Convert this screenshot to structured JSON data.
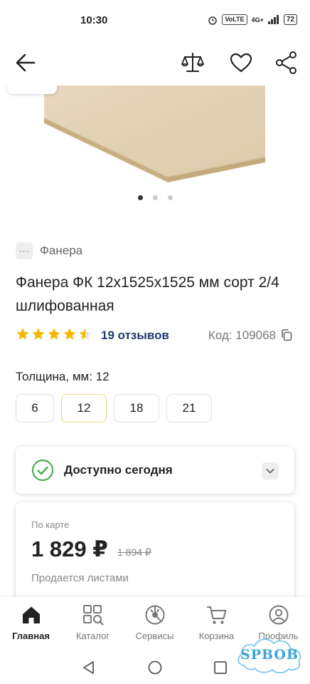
{
  "status_bar": {
    "time": "10:30",
    "volte": "VoLTE",
    "network": "4G+",
    "battery": "72"
  },
  "app_bar": {
    "icons": [
      "back-arrow-icon",
      "compare-scales-icon",
      "heart-icon",
      "share-icon"
    ]
  },
  "gallery": {
    "slide_count": 3,
    "active_slide": 1
  },
  "category": {
    "icon_text": "···",
    "label": "Фанера"
  },
  "product": {
    "title": "Фанера ФК 12x1525x1525 мм сорт 2/4 шлифованная",
    "rating": 4.5,
    "reviews_label": "19 отзывов",
    "code_label": "Код: 109068"
  },
  "thickness": {
    "label": "Толщина, мм: 12",
    "options": [
      "6",
      "12",
      "18",
      "21"
    ],
    "selected": "12"
  },
  "availability": {
    "text": "Доступно сегодня"
  },
  "price": {
    "caption": "По карте",
    "current": "1 829 ₽",
    "old": "1 894 ₽",
    "note": "Продается листами"
  },
  "bottom_nav": {
    "items": [
      {
        "label": "Главная",
        "icon": "home-icon",
        "active": true
      },
      {
        "label": "Каталог",
        "icon": "catalog-icon",
        "active": false
      },
      {
        "label": "Сервисы",
        "icon": "services-icon",
        "active": false
      },
      {
        "label": "Корзина",
        "icon": "cart-icon",
        "active": false
      },
      {
        "label": "Профиль",
        "icon": "profile-icon",
        "active": false
      }
    ]
  },
  "watermark": {
    "text": "SPBOB"
  },
  "colors": {
    "accent_green": "#4caf50",
    "star_yellow": "#f5b800",
    "link_blue": "#1d3b6e",
    "selected_border": "#e9d77b"
  }
}
